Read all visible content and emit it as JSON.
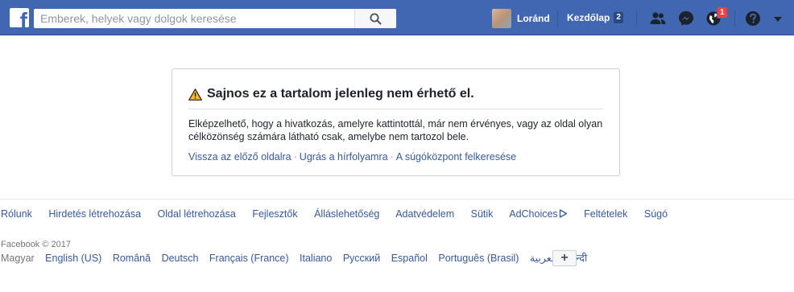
{
  "header": {
    "logo_letter": "f",
    "search_placeholder": "Emberek, helyek vagy dolgok keresése",
    "profile_name": "Loránd",
    "home_label": "Kezdőlap",
    "home_count": "2",
    "notification_count": "1",
    "brand_color": "#4267b2"
  },
  "error_card": {
    "title": "Sajnos ez a tartalom jelenleg nem érhető el.",
    "body": "Elképzelhető, hogy a hivatkozás, amelyre kattintottál, már nem érvényes, vagy az oldal olyan célközönség számára látható csak, amelybe nem tartozol bele.",
    "links": [
      "Vissza az előző oldalra",
      "Ugrás a hírfolyamra",
      "A súgóközpont felkeresése"
    ],
    "separator": "·"
  },
  "footer": {
    "links": [
      "Rólunk",
      "Hirdetés létrehozása",
      "Oldal létrehozása",
      "Fejlesztők",
      "Álláslehetőség",
      "Adatvédelem",
      "Sütik",
      "AdChoices",
      "Feltételek",
      "Súgó"
    ],
    "copyright": "Facebook © 2017",
    "current_language": "Magyar",
    "languages": [
      "English (US)",
      "Română",
      "Deutsch",
      "Français (France)",
      "Italiano",
      "Русский",
      "Español",
      "Português (Brasil)",
      "العربية",
      "हिन्दी"
    ],
    "add_language_label": "+"
  }
}
